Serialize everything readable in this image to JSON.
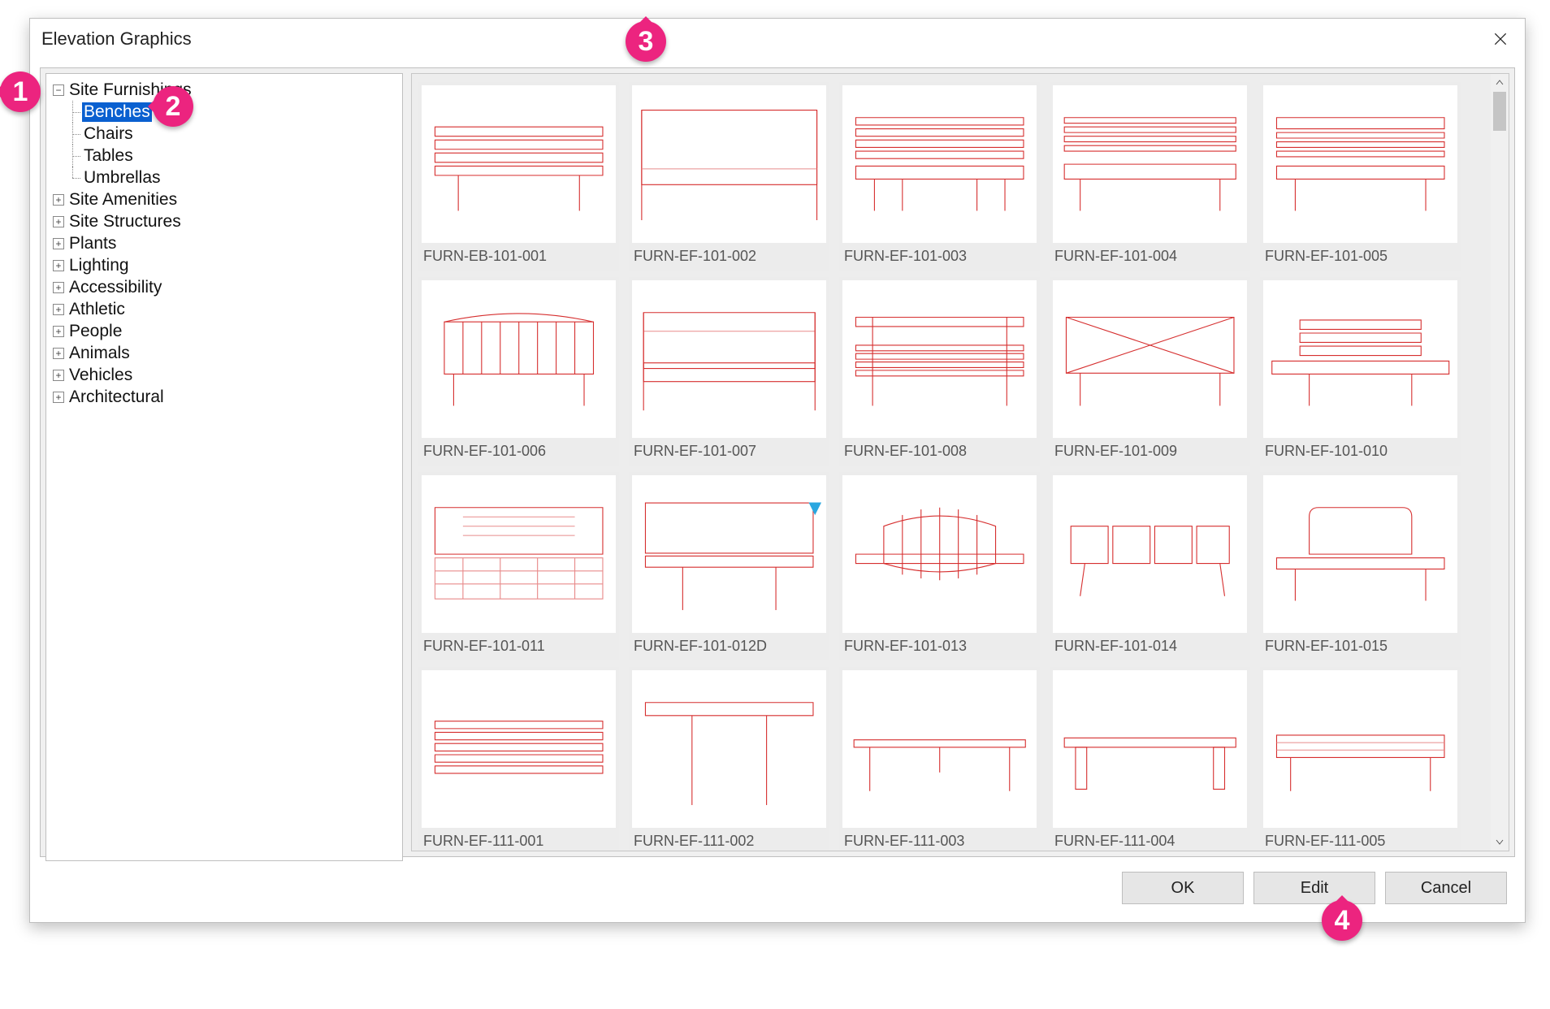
{
  "dialog": {
    "title": "Elevation Graphics"
  },
  "annotations": {
    "b1": "1",
    "b2": "2",
    "b3": "3",
    "b4": "4"
  },
  "tree": {
    "root": {
      "label": "Site Furnishings",
      "children": [
        {
          "label": "Benches",
          "selected": true
        },
        {
          "label": "Chairs"
        },
        {
          "label": "Tables"
        },
        {
          "label": "Umbrellas"
        }
      ]
    },
    "siblings": [
      "Site Amenities",
      "Site Structures",
      "Plants",
      "Lighting",
      "Accessibility",
      "Athletic",
      "People",
      "Animals",
      "Vehicles",
      "Architectural"
    ]
  },
  "grid": [
    "FURN-EB-101-001",
    "FURN-EF-101-002",
    "FURN-EF-101-003",
    "FURN-EF-101-004",
    "FURN-EF-101-005",
    "FURN-EF-101-006",
    "FURN-EF-101-007",
    "FURN-EF-101-008",
    "FURN-EF-101-009",
    "FURN-EF-101-010",
    "FURN-EF-101-011",
    "FURN-EF-101-012D",
    "FURN-EF-101-013",
    "FURN-EF-101-014",
    "FURN-EF-101-015",
    "FURN-EF-111-001",
    "FURN-EF-111-002",
    "FURN-EF-111-003",
    "FURN-EF-111-004",
    "FURN-EF-111-005"
  ],
  "buttons": {
    "ok": "OK",
    "edit": "Edit",
    "cancel": "Cancel"
  }
}
